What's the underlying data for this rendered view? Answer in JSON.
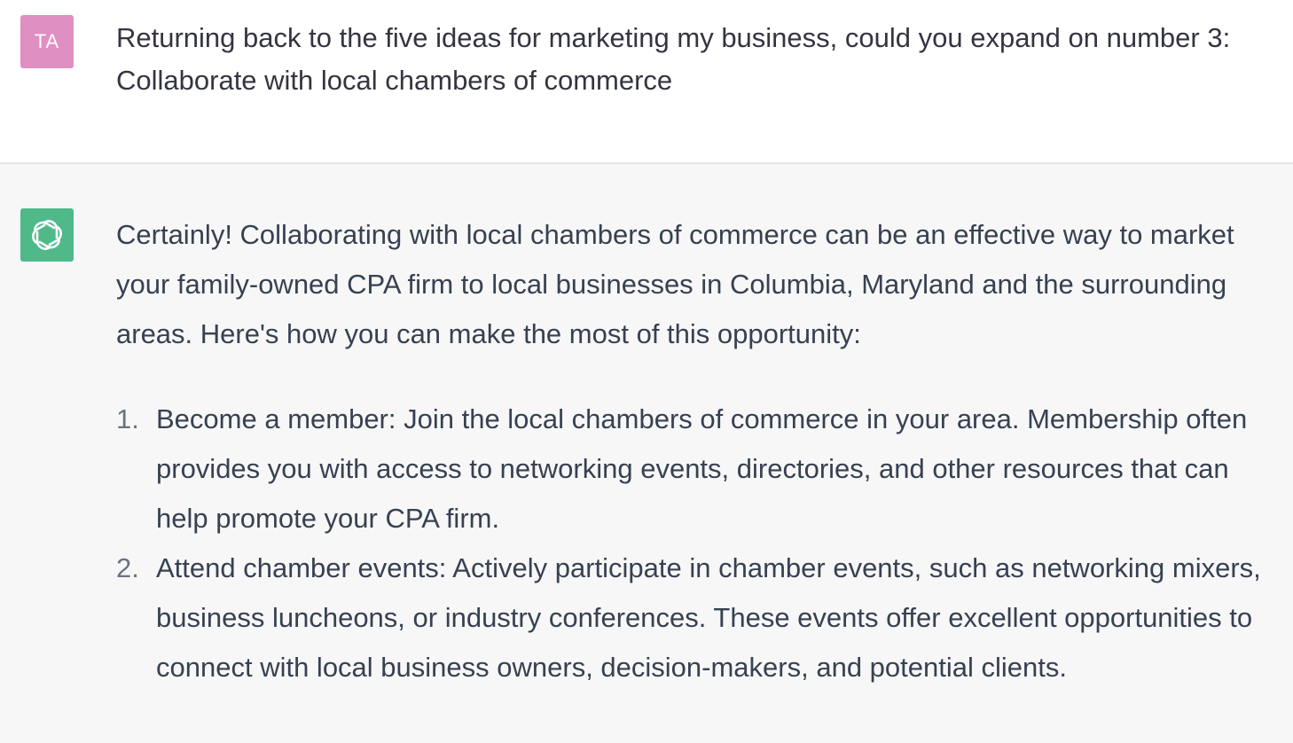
{
  "colors": {
    "user_avatar_bg": "#e08fc2",
    "bot_avatar_bg": "#4fb98a"
  },
  "user_message": {
    "avatar_initials": "TA",
    "text": "Returning back to the five ideas for marketing my business, could you expand on number 3: Collaborate with local chambers of commerce"
  },
  "assistant_message": {
    "avatar_icon": "openai-logo-icon",
    "intro": "Certainly! Collaborating with local chambers of commerce can be an effective way to market your family-owned CPA firm to local businesses in Columbia, Maryland and the surrounding areas. Here's how you can make the most of this opportunity:",
    "items": [
      {
        "number": "1.",
        "text": "Become a member: Join the local chambers of commerce in your area. Membership often provides you with access to networking events, directories, and other resources that can help promote your CPA firm."
      },
      {
        "number": "2.",
        "text": "Attend chamber events: Actively participate in chamber events, such as networking mixers, business luncheons, or industry conferences. These events offer excellent opportunities to connect with local business owners, decision-makers, and potential clients."
      }
    ]
  }
}
